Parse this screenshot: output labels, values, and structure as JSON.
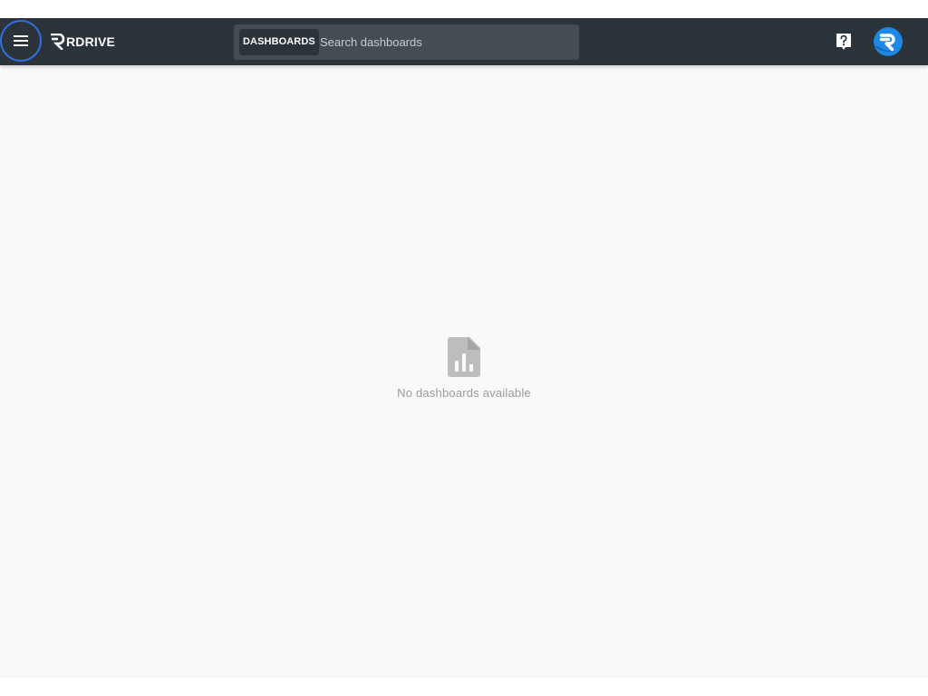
{
  "header": {
    "logo_text": "RDRIVE",
    "menu_icon": "hamburger-menu-icon",
    "search": {
      "chip_label": "DASHBOARDS",
      "placeholder": "Search dashboards",
      "value": ""
    },
    "help_icon": "help-question-icon",
    "avatar_icon": "rdrive-avatar-icon"
  },
  "main": {
    "empty_state": {
      "icon": "dashboard-document-icon",
      "message": "No dashboards available"
    }
  },
  "colors": {
    "topbar": "#2b333b",
    "search_bg": "#454c53",
    "accent_blue": "#1e88e5",
    "focus_ring": "#2f6fe0",
    "content_bg": "#f9f9f9",
    "empty_icon": "#bdbdbd",
    "empty_text": "#9a9a9a"
  }
}
